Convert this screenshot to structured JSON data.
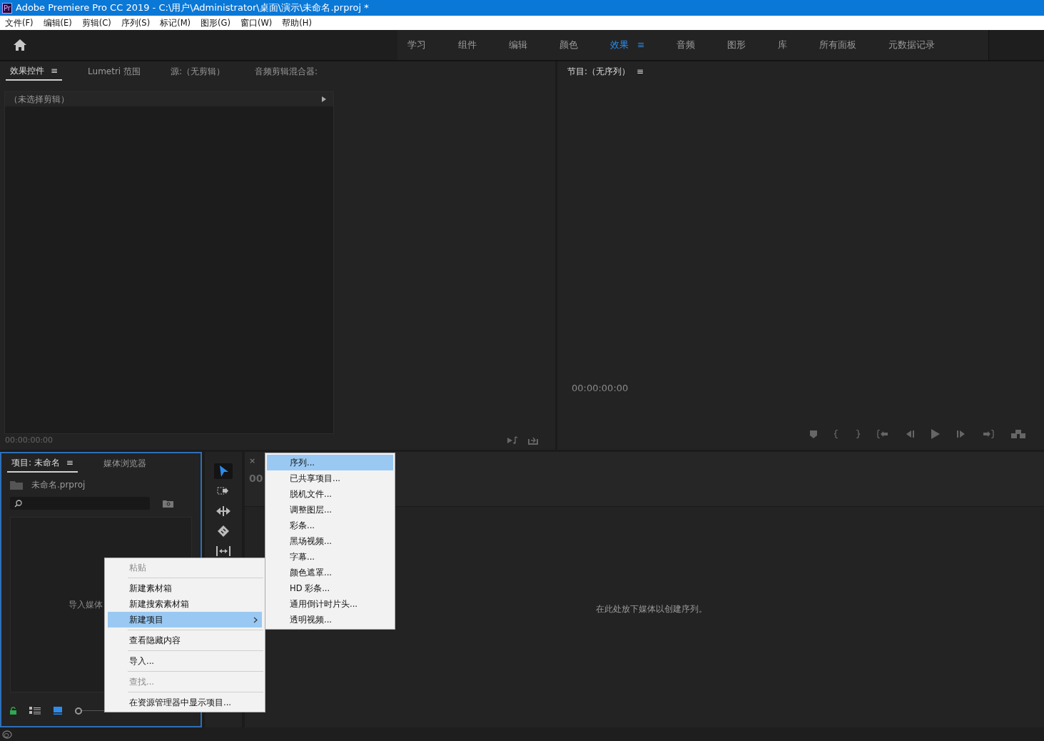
{
  "window": {
    "title": "Adobe Premiere Pro CC 2019 - C:\\用户\\Administrator\\桌面\\演示\\未命名.prproj *",
    "app_badge": "Pr"
  },
  "menu": [
    "文件(F)",
    "编辑(E)",
    "剪辑(C)",
    "序列(S)",
    "标记(M)",
    "图形(G)",
    "窗口(W)",
    "帮助(H)"
  ],
  "workspaces": [
    {
      "label": "学习",
      "selected": false
    },
    {
      "label": "组件",
      "selected": false
    },
    {
      "label": "编辑",
      "selected": false
    },
    {
      "label": "颜色",
      "selected": false
    },
    {
      "label": "效果",
      "selected": true,
      "menu": "≡"
    },
    {
      "label": "音频",
      "selected": false
    },
    {
      "label": "图形",
      "selected": false
    },
    {
      "label": "库",
      "selected": false
    },
    {
      "label": "所有面板",
      "selected": false
    },
    {
      "label": "元数据记录",
      "selected": false
    }
  ],
  "effects_panel": {
    "tabs": [
      {
        "label": "效果控件",
        "selected": true,
        "menu": "≡"
      },
      {
        "label": "Lumetri 范围",
        "selected": false
      },
      {
        "label": "源:（无剪辑）",
        "selected": false
      },
      {
        "label": "音频剪辑混合器:",
        "selected": false
      }
    ],
    "clip_header": "（未选择剪辑）",
    "timecode": "00:00:00:00"
  },
  "program_panel": {
    "title": "节目:（无序列）",
    "menu": "≡",
    "timecode": "00:00:00:00"
  },
  "project_panel": {
    "tabs": [
      {
        "label": "项目: 未命名",
        "selected": true,
        "menu": "≡"
      },
      {
        "label": "媒体浏览器",
        "selected": false
      }
    ],
    "file": "未命名.prproj",
    "empty_hint": "导入媒体",
    "zoom": {
      "level": 0
    }
  },
  "timeline_panel": {
    "close": "×",
    "timecode": "00",
    "drop_hint": "在此处放下媒体以创建序列。"
  },
  "context_menu": [
    {
      "kind": "item",
      "label": "粘贴",
      "disabled": true,
      "selected": false,
      "submenu": false
    },
    {
      "kind": "separator"
    },
    {
      "kind": "item",
      "label": "新建素材箱",
      "disabled": false,
      "selected": false,
      "submenu": false
    },
    {
      "kind": "item",
      "label": "新建搜索素材箱",
      "disabled": false,
      "selected": false,
      "submenu": false
    },
    {
      "kind": "item",
      "label": "新建项目",
      "disabled": false,
      "selected": true,
      "submenu": true
    },
    {
      "kind": "separator"
    },
    {
      "kind": "item",
      "label": "查看隐藏内容",
      "disabled": false,
      "selected": false,
      "submenu": false
    },
    {
      "kind": "separator"
    },
    {
      "kind": "item",
      "label": "导入...",
      "disabled": false,
      "selected": false,
      "submenu": false
    },
    {
      "kind": "separator"
    },
    {
      "kind": "item",
      "label": "查找...",
      "disabled": true,
      "selected": false,
      "submenu": false
    },
    {
      "kind": "separator"
    },
    {
      "kind": "item",
      "label": "在资源管理器中显示项目...",
      "disabled": false,
      "selected": false,
      "submenu": false
    }
  ],
  "submenu": [
    {
      "label": "序列...",
      "selected": true
    },
    {
      "label": "已共享项目...",
      "selected": false
    },
    {
      "label": "脱机文件...",
      "selected": false
    },
    {
      "label": "调整图层...",
      "selected": false
    },
    {
      "label": "彩条...",
      "selected": false
    },
    {
      "label": "黑场视频...",
      "selected": false
    },
    {
      "label": "字幕...",
      "selected": false
    },
    {
      "label": "颜色遮罩...",
      "selected": false
    },
    {
      "label": "HD 彩条...",
      "selected": false
    },
    {
      "label": "通用倒计时片头...",
      "selected": false
    },
    {
      "label": "透明视频...",
      "selected": false
    }
  ]
}
